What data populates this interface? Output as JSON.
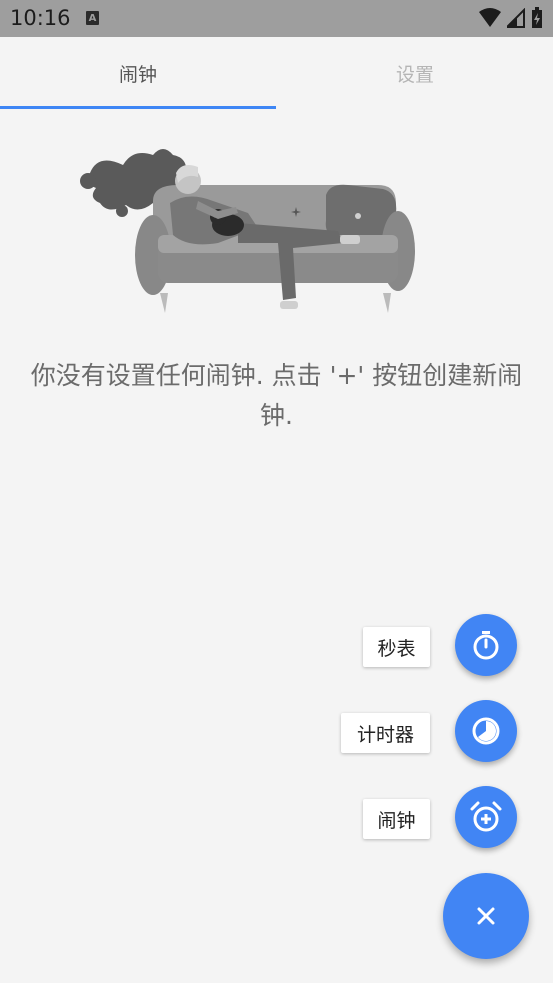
{
  "status_bar": {
    "time": "10:16",
    "notification_icon": "a-icon"
  },
  "tabs": [
    {
      "label": "闹钟",
      "selected": true
    },
    {
      "label": "设置",
      "selected": false
    }
  ],
  "empty_state": {
    "illustration": "person-sleeping-on-sofa-illustration",
    "message": "你没有设置任何闹钟. 点击 '+' 按钮创建新闹钟."
  },
  "fab_menu": {
    "items": [
      {
        "label": "秒表",
        "icon": "stopwatch-icon"
      },
      {
        "label": "计时器",
        "icon": "timer-icon"
      },
      {
        "label": "闹钟",
        "icon": "alarm-add-icon"
      }
    ],
    "close_icon": "close-icon"
  },
  "colors": {
    "accent": "#4185f4",
    "status_bar": "#9e9e9e",
    "background": "#f4f4f4"
  }
}
